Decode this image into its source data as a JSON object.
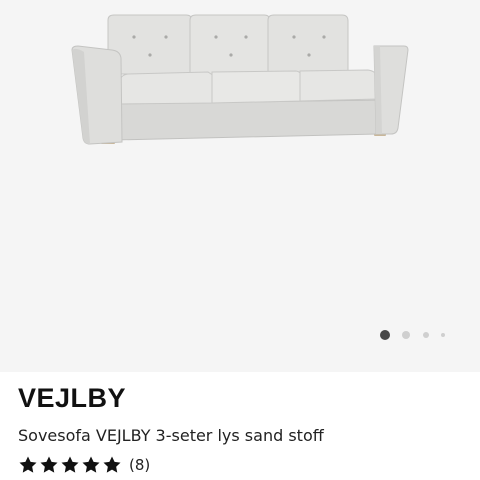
{
  "product": {
    "name": "VEJLBY",
    "description": "Sovesofa VEJLBY 3-seter lys sand stoff",
    "rating_value": 5,
    "rating_max": 5,
    "review_count_label": "(8)",
    "image_icon": "sofa-image"
  },
  "gallery": {
    "total_images": 4,
    "active_index": 0,
    "active_dot_color": "#484848",
    "inactive_dot_color": "#cfcfcf"
  },
  "colors": {
    "gallery_background": "#f5f5f5",
    "text_primary": "#111111",
    "star_color": "#111111",
    "sofa_fabric": "#dcdcda"
  }
}
